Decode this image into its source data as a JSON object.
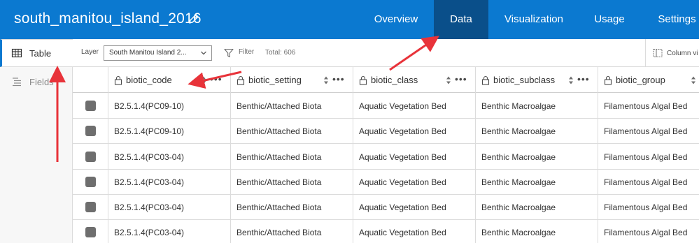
{
  "header": {
    "title": "south_manitou_island_2016",
    "tabs": [
      {
        "label": "Overview"
      },
      {
        "label": "Data"
      },
      {
        "label": "Visualization"
      },
      {
        "label": "Usage"
      },
      {
        "label": "Settings"
      }
    ],
    "active_tab": "Data"
  },
  "sidebar": {
    "items": [
      {
        "label": "Table",
        "icon": "table-icon",
        "active": true
      },
      {
        "label": "Fields",
        "icon": "fields-icon",
        "active": false
      }
    ]
  },
  "toolbar": {
    "layer_label": "Layer",
    "layer_value": "South Manitou Island 2...",
    "filter_label": "Filter",
    "total_text": "Total: 606",
    "column_visibility_label": "Column vi"
  },
  "table": {
    "columns": [
      {
        "label": "biotic_code"
      },
      {
        "label": "biotic_setting"
      },
      {
        "label": "biotic_class"
      },
      {
        "label": "biotic_subclass"
      },
      {
        "label": "biotic_group"
      }
    ],
    "rows": [
      [
        "B2.5.1.4(PC09-10)",
        "Benthic/Attached Biota",
        "Aquatic Vegetation Bed",
        "Benthic Macroalgae",
        "Filamentous Algal Bed"
      ],
      [
        "B2.5.1.4(PC09-10)",
        "Benthic/Attached Biota",
        "Aquatic Vegetation Bed",
        "Benthic Macroalgae",
        "Filamentous Algal Bed"
      ],
      [
        "B2.5.1.4(PC03-04)",
        "Benthic/Attached Biota",
        "Aquatic Vegetation Bed",
        "Benthic Macroalgae",
        "Filamentous Algal Bed"
      ],
      [
        "B2.5.1.4(PC03-04)",
        "Benthic/Attached Biota",
        "Aquatic Vegetation Bed",
        "Benthic Macroalgae",
        "Filamentous Algal Bed"
      ],
      [
        "B2.5.1.4(PC03-04)",
        "Benthic/Attached Biota",
        "Aquatic Vegetation Bed",
        "Benthic Macroalgae",
        "Filamentous Algal Bed"
      ],
      [
        "B2.5.1.4(PC03-04)",
        "Benthic/Attached Biota",
        "Aquatic Vegetation Bed",
        "Benthic Macroalgae",
        "Filamentous Algal Bed"
      ]
    ]
  },
  "colors": {
    "header_blue": "#0b79d0",
    "active_tab": "#0a4f8a",
    "annotation_red": "#e8333a"
  }
}
